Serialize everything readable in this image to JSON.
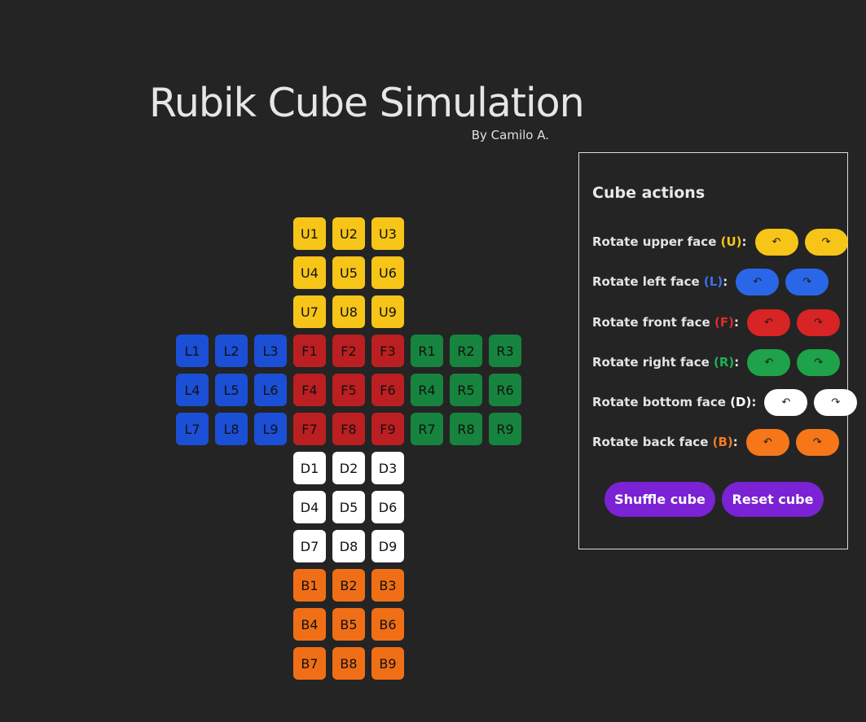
{
  "page": {
    "title": "Rubik Cube Simulation",
    "byline": "By Camilo A."
  },
  "colors": {
    "U": "#f6c518",
    "L": "#1b4fd6",
    "F": "#bc1f21",
    "R": "#16843e",
    "D": "#ffffff",
    "B": "#f06f16",
    "button_primary": "#7b22d4",
    "label_U": "#f6c518",
    "label_L": "#3a6fef",
    "label_F": "#e02a2a",
    "label_R": "#1fb052",
    "label_D": "#ffffff",
    "label_B": "#f47a1f",
    "btn_U": "#f6c518",
    "btn_L": "#2a67e8",
    "btn_F": "#d82424",
    "btn_R": "#1ea24a",
    "btn_D": "#ffffff",
    "btn_B": "#f6771a"
  },
  "cube": {
    "faces": [
      {
        "id": "U",
        "stickers": [
          "U1",
          "U2",
          "U3",
          "U4",
          "U5",
          "U6",
          "U7",
          "U8",
          "U9"
        ]
      },
      {
        "id": "L",
        "stickers": [
          "L1",
          "L2",
          "L3",
          "L4",
          "L5",
          "L6",
          "L7",
          "L8",
          "L9"
        ]
      },
      {
        "id": "F",
        "stickers": [
          "F1",
          "F2",
          "F3",
          "F4",
          "F5",
          "F6",
          "F7",
          "F8",
          "F9"
        ]
      },
      {
        "id": "R",
        "stickers": [
          "R1",
          "R2",
          "R3",
          "R4",
          "R5",
          "R6",
          "R7",
          "R8",
          "R9"
        ]
      },
      {
        "id": "D",
        "stickers": [
          "D1",
          "D2",
          "D3",
          "D4",
          "D5",
          "D6",
          "D7",
          "D8",
          "D9"
        ]
      },
      {
        "id": "B",
        "stickers": [
          "B1",
          "B2",
          "B3",
          "B4",
          "B5",
          "B6",
          "B7",
          "B8",
          "B9"
        ]
      }
    ]
  },
  "actions": {
    "title": "Cube actions",
    "rows": [
      {
        "face": "U",
        "prefix": "Rotate upper face",
        "code": "(U)",
        "suffix": ":",
        "ccw_icon": "rotate-ccw-icon",
        "cw_icon": "rotate-cw-icon"
      },
      {
        "face": "L",
        "prefix": "Rotate left face",
        "code": "(L)",
        "suffix": ":",
        "ccw_icon": "rotate-ccw-icon",
        "cw_icon": "rotate-cw-icon"
      },
      {
        "face": "F",
        "prefix": "Rotate front face",
        "code": "(F)",
        "suffix": ":",
        "ccw_icon": "rotate-ccw-icon",
        "cw_icon": "rotate-cw-icon"
      },
      {
        "face": "R",
        "prefix": "Rotate right face",
        "code": "(R)",
        "suffix": ":",
        "ccw_icon": "rotate-ccw-icon",
        "cw_icon": "rotate-cw-icon"
      },
      {
        "face": "D",
        "prefix": "Rotate bottom face",
        "code": "(D)",
        "suffix": ":",
        "ccw_icon": "rotate-ccw-icon",
        "cw_icon": "rotate-cw-icon"
      },
      {
        "face": "B",
        "prefix": "Rotate back face",
        "code": "(B)",
        "suffix": ":",
        "ccw_icon": "rotate-ccw-icon",
        "cw_icon": "rotate-cw-icon"
      }
    ],
    "shuffle_label": "Shuffle cube",
    "reset_label": "Reset cube"
  }
}
